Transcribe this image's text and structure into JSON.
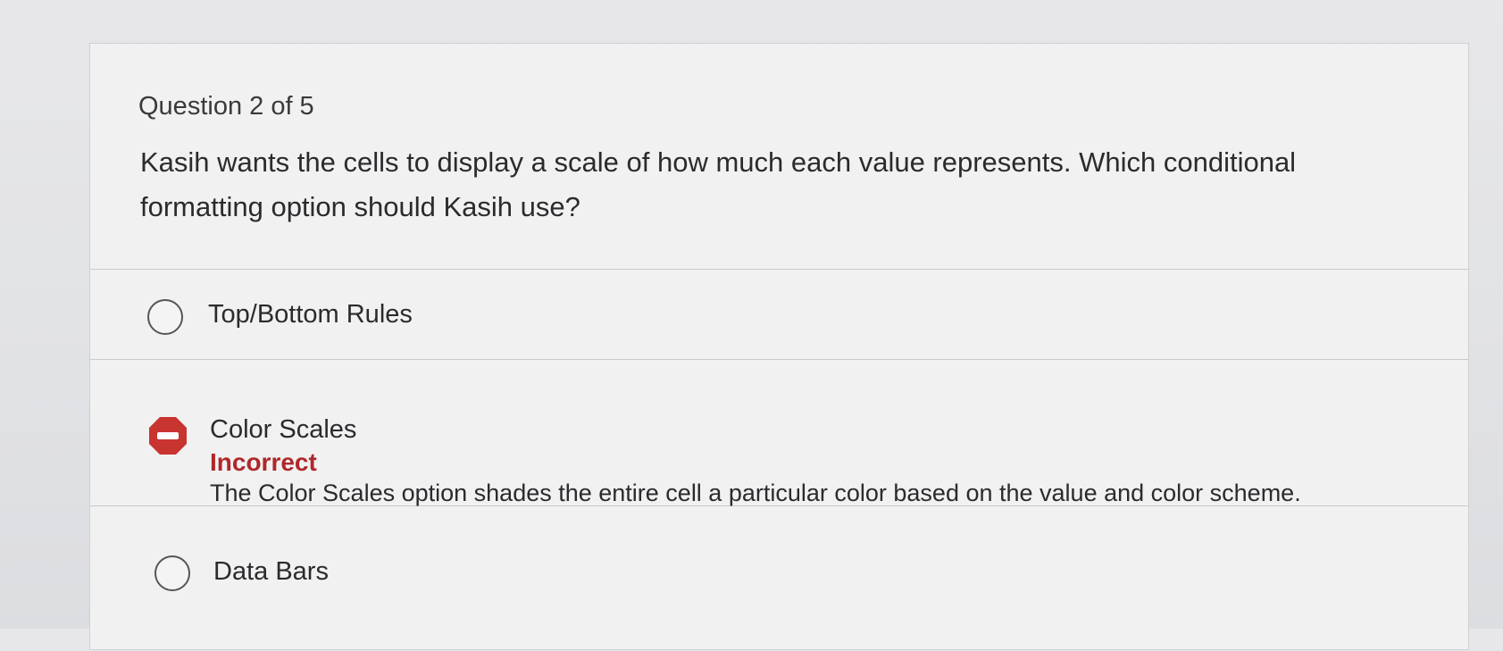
{
  "question": {
    "counter": "Question 2 of 5",
    "prompt": "Kasih wants the cells to display a scale of how much each value represents. Which conditional formatting option should Kasih use?"
  },
  "options": [
    {
      "label": "Top/Bottom Rules",
      "state": "unselected"
    },
    {
      "label": "Color Scales",
      "state": "incorrect",
      "feedback_status": "Incorrect",
      "feedback_text": "The Color Scales option shades the entire cell a particular color based on the value and color scheme."
    },
    {
      "label": "Data Bars",
      "state": "unselected"
    }
  ],
  "icons": {
    "incorrect": "stop-minus-icon"
  },
  "colors": {
    "incorrect_red": "#c8342f",
    "incorrect_text": "#b0282a"
  }
}
